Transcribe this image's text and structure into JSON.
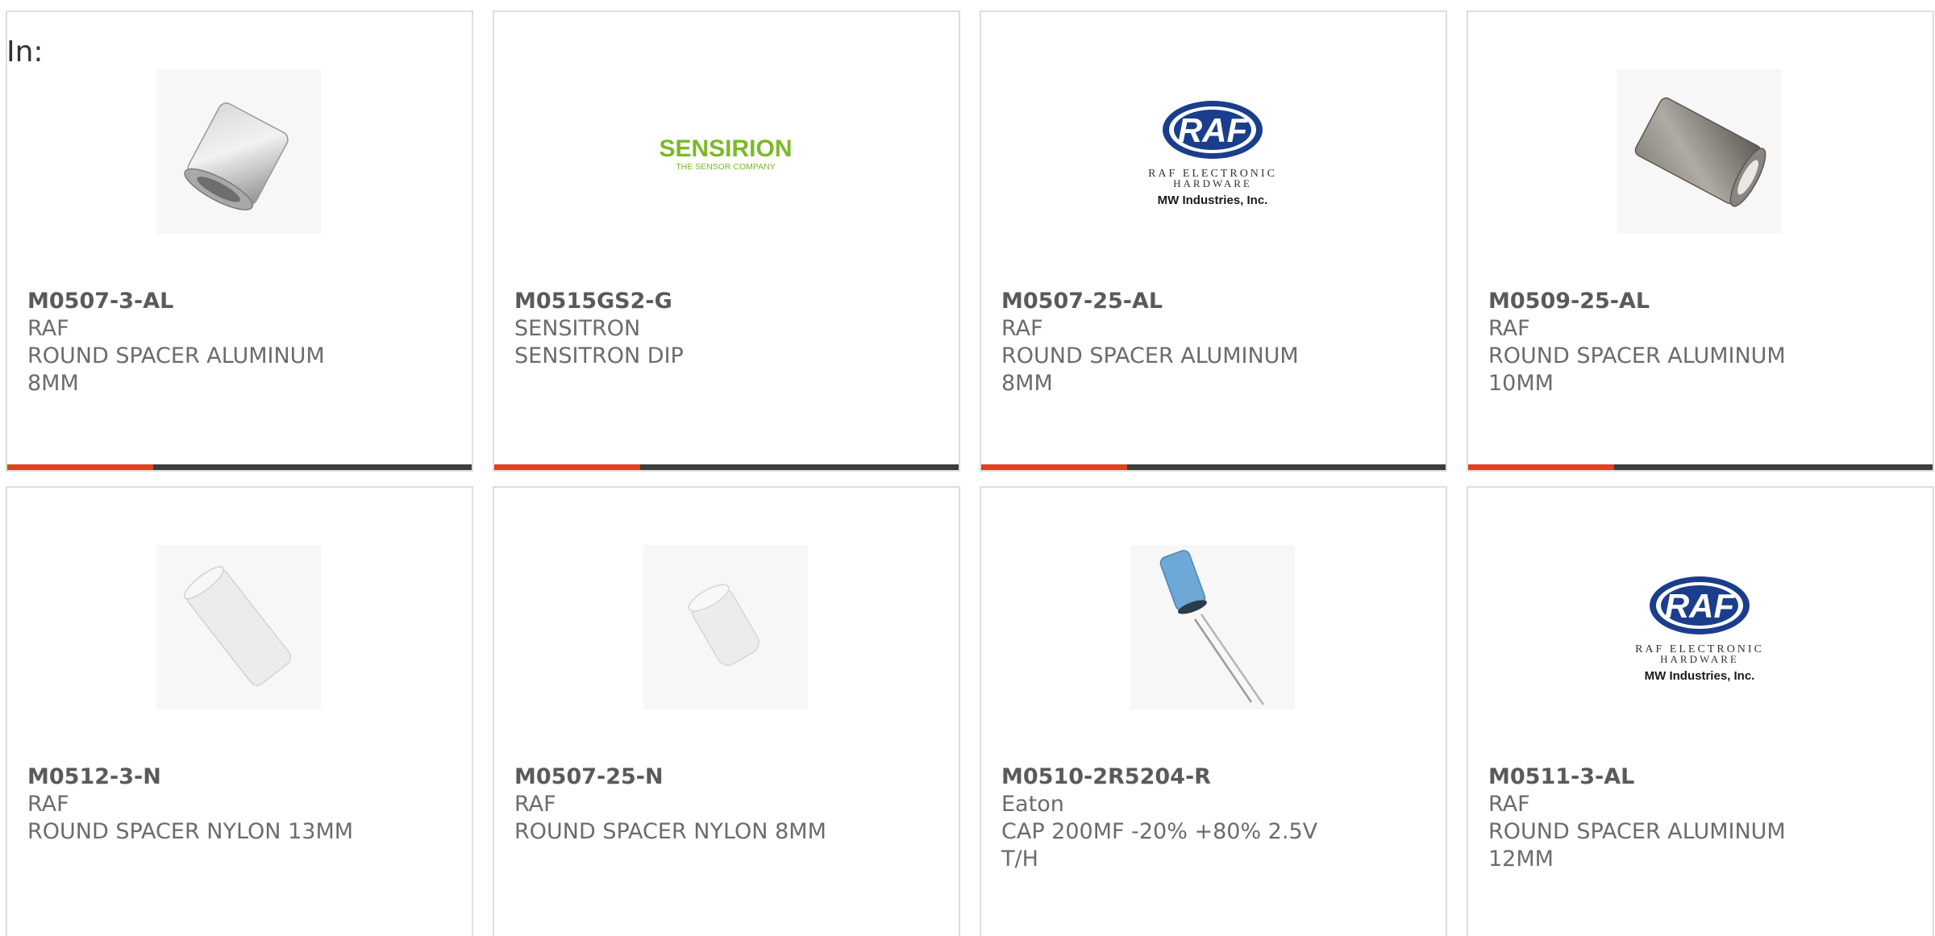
{
  "filter_label": "In:",
  "colors": {
    "card_border": "#dedede",
    "accent_bar": "#e1401b",
    "dark_bar": "#3d3d3d",
    "text": "#6b6b6b",
    "sensirion_green": "#7ab929",
    "raf_blue": "#1a3e8c"
  },
  "products": [
    {
      "part_number": "M0507-3-AL",
      "manufacturer": "RAF",
      "description": "ROUND SPACER ALUMINUM 8MM",
      "image": "metal-spacer-short-icon",
      "highlight_fraction": 0.315
    },
    {
      "part_number": "M0515GS2-G",
      "manufacturer": "SENSITRON",
      "description": "SENSITRON DIP",
      "image": "sensirion-logo",
      "logo_text": "SENSIRION",
      "logo_tagline": "THE SENSOR COMPANY",
      "highlight_fraction": 0.315
    },
    {
      "part_number": "M0507-25-AL",
      "manufacturer": "RAF",
      "description": "ROUND SPACER ALUMINUM 8MM",
      "image": "raf-logo",
      "logo_text": "RAF",
      "logo_line1": "RAF ELECTRONIC",
      "logo_line2": "HARDWARE",
      "logo_line3": "MW Industries, Inc.",
      "highlight_fraction": 0.315
    },
    {
      "part_number": "M0509-25-AL",
      "manufacturer": "RAF",
      "description": "ROUND SPACER ALUMINUM 10MM",
      "image": "metal-spacer-long-icon",
      "highlight_fraction": 0.315
    },
    {
      "part_number": "M0512-3-N",
      "manufacturer": "RAF",
      "description": "ROUND SPACER NYLON 13MM",
      "image": "nylon-spacer-long-icon"
    },
    {
      "part_number": "M0507-25-N",
      "manufacturer": "RAF",
      "description": "ROUND SPACER NYLON 8MM",
      "image": "nylon-spacer-short-icon"
    },
    {
      "part_number": "M0510-2R5204-R",
      "manufacturer": "Eaton",
      "description": "CAP 200MF -20% +80% 2.5V T/H",
      "image": "capacitor-icon"
    },
    {
      "part_number": "M0511-3-AL",
      "manufacturer": "RAF",
      "description": "ROUND SPACER ALUMINUM 12MM",
      "image": "raf-logo",
      "logo_text": "RAF",
      "logo_line1": "RAF ELECTRONIC",
      "logo_line2": "HARDWARE",
      "logo_line3": "MW Industries, Inc."
    }
  ]
}
